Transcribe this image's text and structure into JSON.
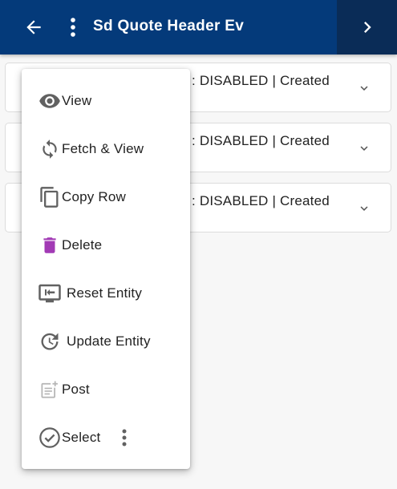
{
  "header": {
    "title": "Sd Quote Header Ev",
    "back_icon": "arrow-left-icon",
    "more_icon": "vertical-dots-icon",
    "next_icon": "chevron-right-icon",
    "bar_color": "#043a7a",
    "next_color": "#0a2c57"
  },
  "rows": [
    {
      "status": ": DISABLED | Created"
    },
    {
      "status": ": DISABLED | Created"
    },
    {
      "status": ": DISABLED | Created"
    }
  ],
  "context_menu": {
    "items": [
      {
        "label": "View",
        "icon": "eye-icon"
      },
      {
        "label": "Fetch & View",
        "icon": "refresh-icon"
      },
      {
        "label": "Copy Row",
        "icon": "copy-icon"
      },
      {
        "label": "Delete",
        "icon": "trash-icon",
        "icon_color": "#a23ab5"
      },
      {
        "label": "Reset Entity",
        "icon": "reset-entity-icon"
      },
      {
        "label": "Update Entity",
        "icon": "update-history-icon"
      },
      {
        "label": "Post",
        "icon": "post-note-icon"
      },
      {
        "label": "Select",
        "icon": "check-circle-icon"
      }
    ],
    "select_more_icon": "vertical-dots-icon"
  }
}
